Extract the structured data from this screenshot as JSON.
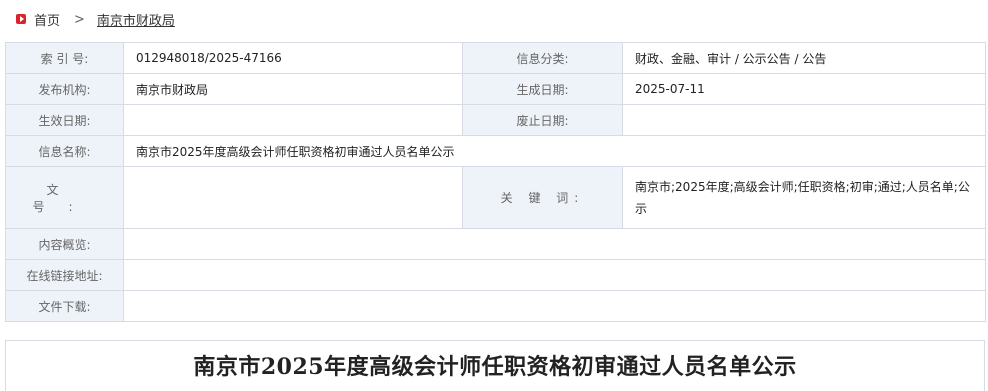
{
  "breadcrumb": {
    "home_icon": "home-icon",
    "home": "首页",
    "separator": ">",
    "current": "南京市财政局"
  },
  "info_table": {
    "index_number_label": "索 引 号:",
    "index_number": "012948018/2025-47166",
    "category_label": "信息分类:",
    "category": "财政、金融、审计 / 公示公告 / 公告",
    "publisher_label": "发布机构:",
    "publisher": "南京市财政局",
    "created_date_label": "生成日期:",
    "created_date": "2025-07-11",
    "effective_date_label": "生效日期:",
    "effective_date": "",
    "expiry_date_label": "废止日期:",
    "expiry_date": "",
    "info_name_label": "信息名称:",
    "info_name": "南京市2025年度高级会计师任职资格初审通过人员名单公示",
    "doc_number_label": "文 号:",
    "doc_number": "",
    "keywords_label": "关 键 词:",
    "keywords": "南京市;2025年度;高级会计师;任职资格;初审;通过;人员名单;公示",
    "summary_label": "内容概览:",
    "summary": "",
    "online_link_label": "在线链接地址:",
    "online_link": "",
    "download_label": "文件下载:",
    "download": ""
  },
  "document": {
    "title": "南京市2025年度高级会计师任职资格初审通过人员名单公示"
  },
  "colors": {
    "label_bg": "#eef3f9",
    "border": "#d6dbe4",
    "home_icon": "#d9252a"
  }
}
